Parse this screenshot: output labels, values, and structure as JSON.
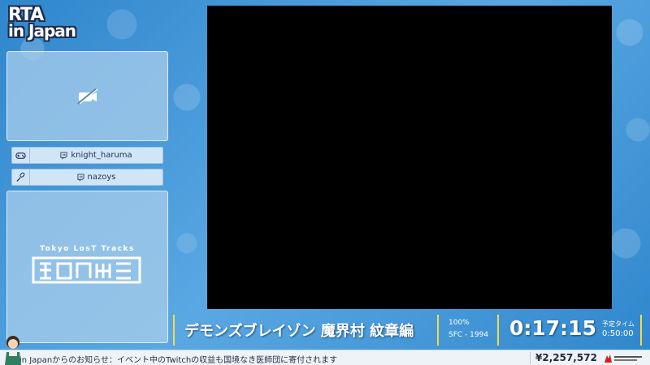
{
  "logo": {
    "line1": "RTA",
    "line2": "in Japan",
    "accent": "ac"
  },
  "camera": {
    "icon": "camera-off-icon"
  },
  "runners": [
    {
      "role": "runner",
      "role_icon": "gamepad-icon",
      "name": "knight_haruma",
      "platform_icon": "twitch-icon"
    },
    {
      "role": "commentator",
      "role_icon": "microphone-icon",
      "name": "nazoys",
      "platform_icon": "twitch-icon"
    }
  ],
  "sponsor_art": {
    "caption": "Tokyo LosT Tracks"
  },
  "game": {
    "title": "デモンズブレイゾン 魔界村 紋章編",
    "category": "100%",
    "platform": "SFC - 1994",
    "timer": "0:17:15",
    "estimate_label": "予定タイム",
    "estimate": "0:50:00"
  },
  "ticker": {
    "message": "in Japanからのお知らせ：イベント中のTwitchの収益も国境なき医師団に寄付されます",
    "donation_total": "¥2,257,572",
    "charity_logo": "msf-logo"
  },
  "colors": {
    "background": "#3d93d6",
    "separator": "#f4d94a",
    "panel": "#aacdeb",
    "text_dark": "#1f3350"
  }
}
